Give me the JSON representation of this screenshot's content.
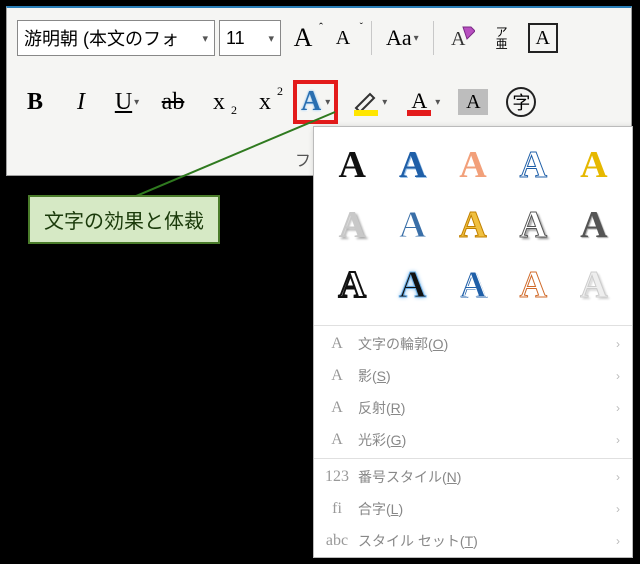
{
  "ribbon": {
    "font_name": "游明朝 (本文のフォ",
    "font_size": "11",
    "aa_case": "Aa",
    "ruby": "ア\n亜",
    "charbox": "A",
    "group_label": "フォン"
  },
  "row2": {
    "bold": "B",
    "italic": "I",
    "underline": "U",
    "strike": "ab",
    "sub": "x",
    "sub_two": "2",
    "sup": "x",
    "sup_two": "2",
    "texteffect": "A",
    "fontcolor_a": "A",
    "shade_a": "A",
    "circled": "字"
  },
  "callout": "文字の効果と体裁",
  "dropdown": {
    "presets": [
      {
        "txt": "A",
        "fill": "#111",
        "stroke": "none",
        "shadow": "none"
      },
      {
        "txt": "A",
        "fill": "#1f5fa8",
        "stroke": "none",
        "shadow": "1px 1px 0 #9cc4ea"
      },
      {
        "txt": "A",
        "fill": "#f2a07a",
        "stroke": "none",
        "shadow": "none"
      },
      {
        "txt": "A",
        "fill": "#fff",
        "stroke": "#1f5fa8",
        "shadow": "none"
      },
      {
        "txt": "A",
        "fill": "#e6b800",
        "stroke": "none",
        "shadow": "none"
      },
      {
        "txt": "A",
        "fill": "#c8c8c8",
        "stroke": "none",
        "shadow": "2px 2px 2px #aaa"
      },
      {
        "txt": "A",
        "fill": "#3a6fa8",
        "stroke": "#fff",
        "shadow": "none"
      },
      {
        "txt": "A",
        "fill": "#f0c040",
        "stroke": "#c08000",
        "shadow": "none"
      },
      {
        "txt": "A",
        "fill": "#fff",
        "stroke": "#555",
        "shadow": "2px 2px 2px #888"
      },
      {
        "txt": "A",
        "fill": "#555",
        "stroke": "none",
        "shadow": "1px 1px 1px #aaa"
      },
      {
        "txt": "A",
        "fill": "#fff",
        "stroke": "#111",
        "shadow": "none",
        "sw": "2"
      },
      {
        "txt": "A",
        "fill": "#111",
        "stroke": "#6db0e8",
        "shadow": "0 0 4px #6db0e8"
      },
      {
        "txt": "A",
        "fill": "#1f5fa8",
        "stroke": "#fff",
        "shadow": "1px 1px 0 #1f5fa8"
      },
      {
        "txt": "A",
        "fill": "#fff",
        "stroke": "#d06a2a",
        "shadow": "none"
      },
      {
        "txt": "A",
        "fill": "#eee",
        "stroke": "#ccc",
        "shadow": "2px 2px 2px #ccc"
      }
    ],
    "items": [
      {
        "icon": "A",
        "label_pre": "文字の輪郭(",
        "ul": "O",
        "label_post": ")"
      },
      {
        "icon": "A",
        "label_pre": "影(",
        "ul": "S",
        "label_post": ")"
      },
      {
        "icon": "A",
        "label_pre": "反射(",
        "ul": "R",
        "label_post": ")"
      },
      {
        "icon": "A",
        "label_pre": "光彩(",
        "ul": "G",
        "label_post": ")"
      },
      {
        "icon": "123",
        "label_pre": "番号スタイル(",
        "ul": "N",
        "label_post": ")"
      },
      {
        "icon": "fi",
        "label_pre": "合字(",
        "ul": "L",
        "label_post": ")"
      },
      {
        "icon": "abc",
        "label_pre": "スタイル セット(",
        "ul": "T",
        "label_post": ")"
      }
    ]
  }
}
